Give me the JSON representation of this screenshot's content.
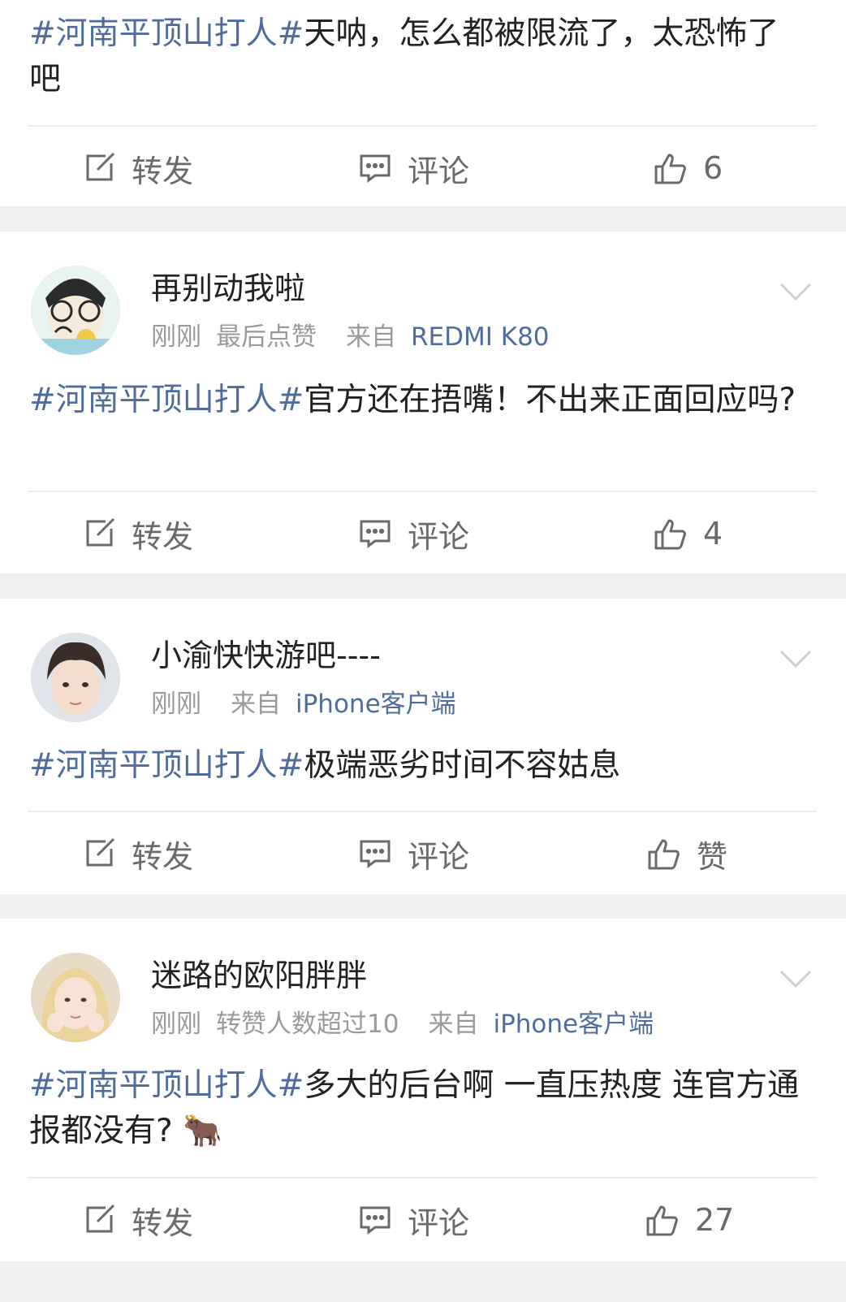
{
  "labels": {
    "repost": "转发",
    "comment": "评论"
  },
  "colors": {
    "topic": "#4f6c9c",
    "meta": "#9a9a9a",
    "separator": "#f0f0f0"
  },
  "posts": [
    {
      "topic": "#河南平顶山打人#",
      "text": "天呐，怎么都被限流了，太恐怖了吧",
      "like_label": "6"
    },
    {
      "username": "再别动我啦",
      "time": "刚刚",
      "extra": "最后点赞",
      "source_prefix": "来自",
      "source": "REDMI K80",
      "topic": "#河南平顶山打人#",
      "text": "官方还在捂嘴！不出来正面回应吗?",
      "like_label": "4"
    },
    {
      "username": "小渝快快游吧----",
      "time": "刚刚",
      "extra": "",
      "source_prefix": "来自",
      "source": "iPhone客户端",
      "topic": "#河南平顶山打人#",
      "text": "极端恶劣时间不容姑息",
      "like_label": "赞"
    },
    {
      "username": "迷路的欧阳胖胖",
      "time": "刚刚",
      "extra": "转赞人数超过10",
      "source_prefix": "来自",
      "source": "iPhone客户端",
      "topic": "#河南平顶山打人#",
      "text": "多大的后台啊 一直压热度 连官方通报都没有? 🐂",
      "like_label": "27"
    }
  ]
}
